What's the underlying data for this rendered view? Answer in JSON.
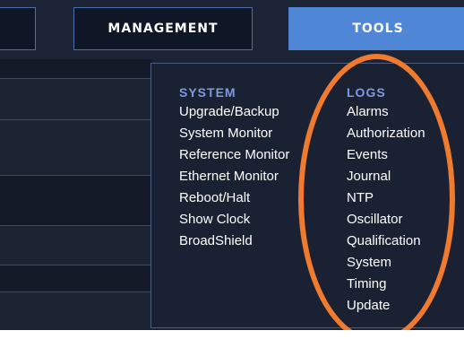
{
  "nav": {
    "partial_label": "",
    "management_label": "MANAGEMENT",
    "tools_label": "TOOLS"
  },
  "menu": {
    "system": {
      "heading": "SYSTEM",
      "items": [
        "Upgrade/Backup",
        "System Monitor",
        "Reference Monitor",
        "Ethernet Monitor",
        "Reboot/Halt",
        "Show Clock",
        "BroadShield"
      ]
    },
    "logs": {
      "heading": "LOGS",
      "items": [
        "Alarms",
        "Authorization",
        "Events",
        "Journal",
        "NTP",
        "Oscillator",
        "Qualification",
        "System",
        "Timing",
        "Update"
      ]
    }
  },
  "colors": {
    "background": "#1c2333",
    "navbar": "#1d2435",
    "active_tab": "#4f86d6",
    "heading": "#7f9ae0",
    "annotation": "#f07a2e"
  }
}
